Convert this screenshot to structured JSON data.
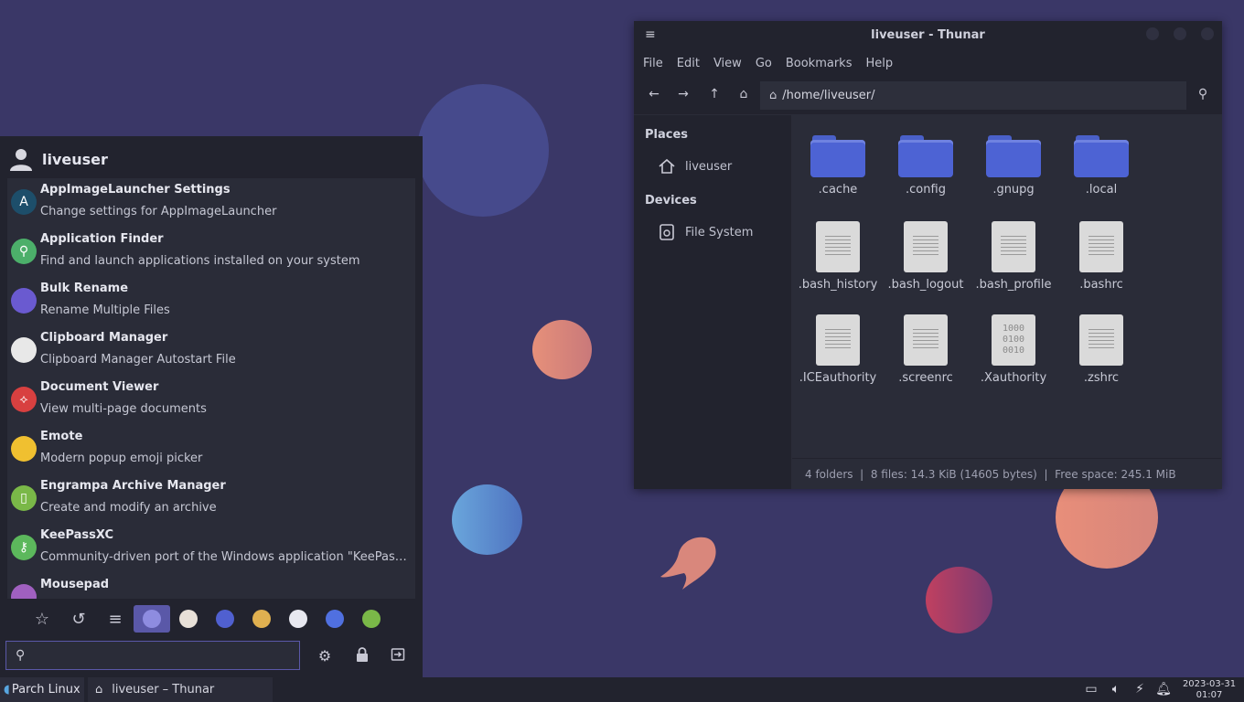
{
  "desktop": {
    "background": "#3a3767"
  },
  "thunar": {
    "title": "liveuser - Thunar",
    "menu": [
      "File",
      "Edit",
      "View",
      "Go",
      "Bookmarks",
      "Help"
    ],
    "address": "/home/liveuser/",
    "sidebar": {
      "places_heading": "Places",
      "places": [
        {
          "label": "liveuser",
          "icon": "home-icon"
        }
      ],
      "devices_heading": "Devices",
      "devices": [
        {
          "label": "File System",
          "icon": "drive-icon"
        }
      ]
    },
    "files": [
      {
        "name": ".cache",
        "kind": "folder"
      },
      {
        "name": ".config",
        "kind": "folder"
      },
      {
        "name": ".gnupg",
        "kind": "folder"
      },
      {
        "name": ".local",
        "kind": "folder"
      },
      {
        "name": ".bash_history",
        "kind": "text"
      },
      {
        "name": ".bash_logout",
        "kind": "text"
      },
      {
        "name": ".bash_profile",
        "kind": "text"
      },
      {
        "name": ".bashrc",
        "kind": "text"
      },
      {
        "name": ".ICEauthority",
        "kind": "text"
      },
      {
        "name": ".screenrc",
        "kind": "text"
      },
      {
        "name": ".Xauthority",
        "kind": "binary",
        "glyph": "1000\n0100\n0010"
      },
      {
        "name": ".zshrc",
        "kind": "text"
      }
    ],
    "status": "4 folders  |  8 files: 14.3 KiB (14605 bytes)  |  Free space: 245.1 MiB"
  },
  "appmenu": {
    "username": "liveuser",
    "apps": [
      {
        "name": "AppImageLauncher Settings",
        "desc": "Change settings for AppImageLauncher",
        "color": "#1d4e6a",
        "glyph": "A"
      },
      {
        "name": "Application Finder",
        "desc": "Find and launch applications installed on your system",
        "color": "#4caf6a",
        "glyph": "⚲"
      },
      {
        "name": "Bulk Rename",
        "desc": "Rename Multiple Files",
        "color": "#6a5ad0",
        "glyph": ""
      },
      {
        "name": "Clipboard Manager",
        "desc": "Clipboard Manager Autostart File",
        "color": "#e8e8e8",
        "glyph": ""
      },
      {
        "name": "Document Viewer",
        "desc": "View multi-page documents",
        "color": "#d84040",
        "glyph": "⟡"
      },
      {
        "name": "Emote",
        "desc": "Modern popup emoji picker",
        "color": "#f0c030",
        "glyph": ""
      },
      {
        "name": "Engrampa Archive Manager",
        "desc": "Create and modify an archive",
        "color": "#7ab848",
        "glyph": "▯"
      },
      {
        "name": "KeePassXC",
        "desc": "Community-driven port of the Windows application \"KeePass Pass...",
        "color": "#5cb85c",
        "glyph": "⚷"
      },
      {
        "name": "Mousepad",
        "desc": "",
        "color": "#a060c0",
        "glyph": ""
      }
    ],
    "categories": [
      {
        "name": "favorites-icon",
        "glyph": "☆"
      },
      {
        "name": "recent-icon",
        "glyph": "↺"
      },
      {
        "name": "all-apps-icon",
        "glyph": "≡"
      },
      {
        "name": "accessibility-icon",
        "color": "#5a58a8",
        "selected": true
      },
      {
        "name": "accessories-icon",
        "color": "#e8e0d8"
      },
      {
        "name": "development-icon",
        "color": "#5060d0"
      },
      {
        "name": "graphics-icon",
        "color": "#e0b050"
      },
      {
        "name": "internet-icon",
        "color": "#e8e8f0"
      },
      {
        "name": "multimedia-icon",
        "color": "#5070e0"
      },
      {
        "name": "settings-category-icon",
        "color": "#7ab848"
      }
    ],
    "search_placeholder": ""
  },
  "taskbar": {
    "start_label": "Parch Linux",
    "window_button": "liveuser – Thunar",
    "clock_date": "2023-03-31",
    "clock_time": "01:07"
  }
}
